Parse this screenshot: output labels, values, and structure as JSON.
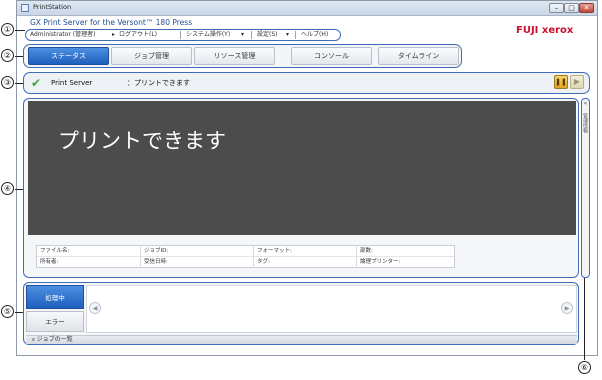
{
  "window": {
    "title": "PrintStation",
    "minimize_glyph": "–",
    "maximize_glyph": "□",
    "close_glyph": "✕"
  },
  "header": {
    "app_title": "GX Print Server for the Versont™ 180 Press",
    "logo_text": "FUJI xerox",
    "logo_color": "#c8102e"
  },
  "menu": {
    "user": "Administrator (管理者)",
    "logout": "ログアウト(L)",
    "system": "システム操作(Y)",
    "settings": "設定(S)",
    "help": "ヘルプ(H)"
  },
  "tabs": [
    "ステータス",
    "ジョブ管理",
    "リソース管理",
    "コンソール",
    "タイムライン"
  ],
  "status": {
    "server_name": "Print Server",
    "message": "：プリントできます",
    "check_icon": "checkmark-icon",
    "pause_glyph": "❚❚",
    "play_glyph": "▶"
  },
  "main": {
    "big_status": "プリントできます",
    "info_labels": [
      [
        "ファイル名:",
        "ジョブID:",
        "フォーマット:",
        "部数:"
      ],
      [
        "所有者:",
        "受信日時:",
        "タグ:",
        "論理プリンター:"
      ]
    ]
  },
  "side_panel": {
    "chevron": "«",
    "label": "管理情報"
  },
  "jobs": {
    "active_tab": "処理中",
    "error_tab": "エラー",
    "footer_label": "ジョブの一覧",
    "footer_chevron": "»",
    "prev_glyph": "◀",
    "next_glyph": "▶"
  },
  "callouts": [
    "①",
    "②",
    "③",
    "④",
    "⑤",
    "⑥"
  ],
  "colors": {
    "accent_blue": "#3d6cb9",
    "active_tab": "#1f5fbf",
    "status_dark": "#4c4c4c",
    "check_green": "#3aa635"
  }
}
